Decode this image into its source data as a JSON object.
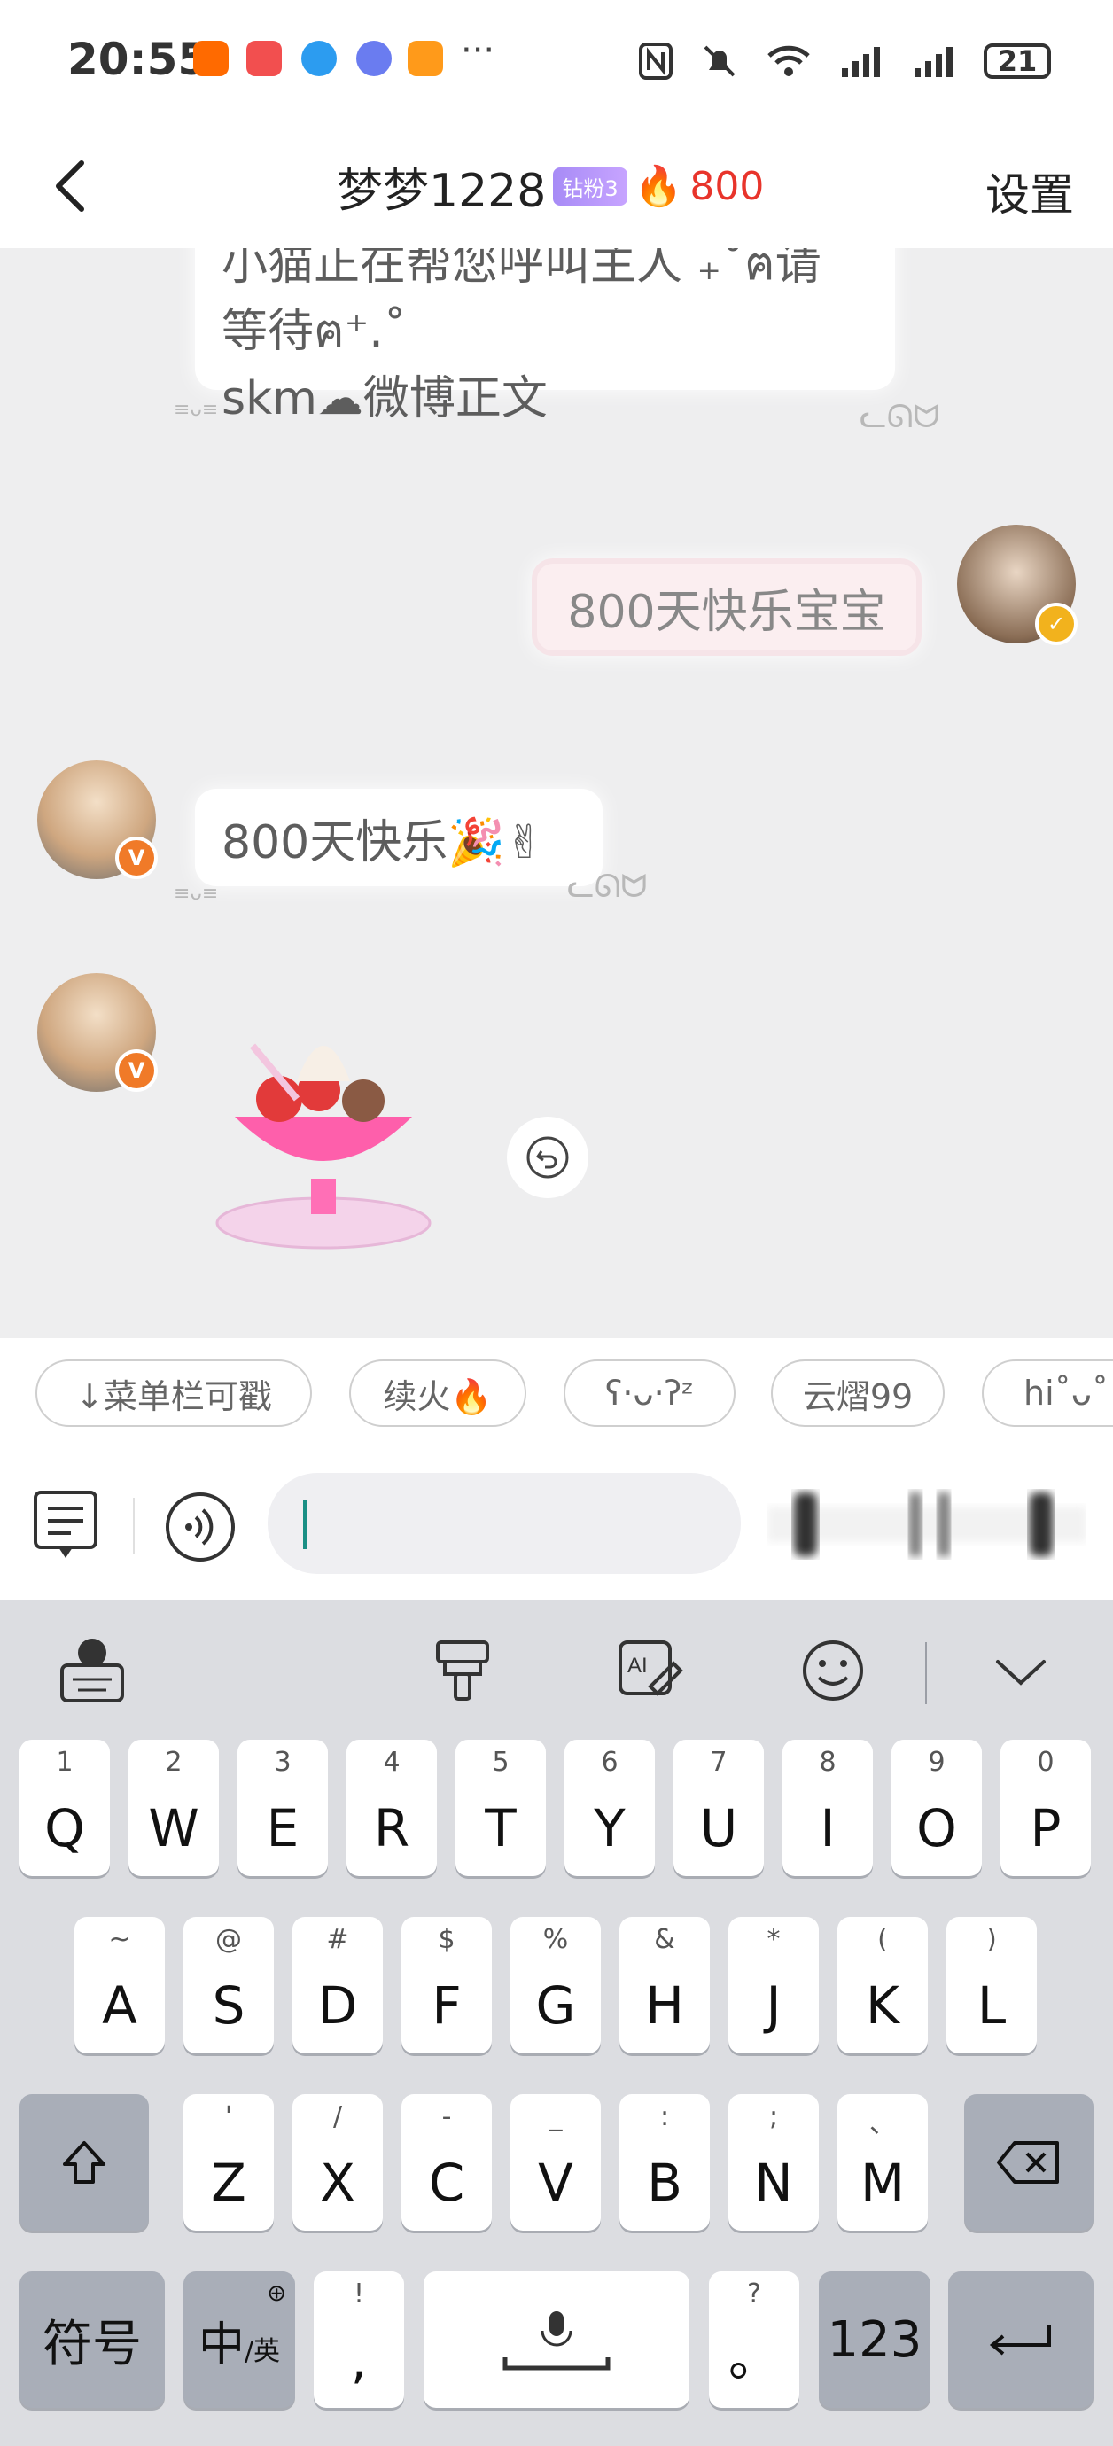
{
  "status_bar": {
    "time": "20:55",
    "more": "···",
    "battery": "21"
  },
  "header": {
    "back_icon": "chevron-left-icon",
    "title": "梦梦1228",
    "fan_badge": "钻粉3",
    "flame_icon": "🔥",
    "flame_count": "800",
    "settings": "设置"
  },
  "messages": {
    "msg1_line1": "小猫正在帮您呼叫主人 ₊˚ฅ请",
    "msg1_line2": "等待ฅ⁺.˚",
    "msg1_line3": "skm☁微博正文",
    "msg2": "800天快乐宝宝",
    "msg3": "800天快乐🎉✌",
    "decor_tag": "≡ᴗ≡"
  },
  "chips": [
    {
      "label": "↓菜单栏可戳"
    },
    {
      "label": "续火🔥"
    },
    {
      "label": "ʕ·ᴗ·ʔᶻ"
    },
    {
      "label": "云熠99"
    },
    {
      "label": "hi˚ᴗ˚"
    }
  ],
  "keyboard": {
    "row1": [
      {
        "sub": "1",
        "main": "Q"
      },
      {
        "sub": "2",
        "main": "W"
      },
      {
        "sub": "3",
        "main": "E"
      },
      {
        "sub": "4",
        "main": "R"
      },
      {
        "sub": "5",
        "main": "T"
      },
      {
        "sub": "6",
        "main": "Y"
      },
      {
        "sub": "7",
        "main": "U"
      },
      {
        "sub": "8",
        "main": "I"
      },
      {
        "sub": "9",
        "main": "O"
      },
      {
        "sub": "0",
        "main": "P"
      }
    ],
    "row2": [
      {
        "sub": "~",
        "main": "A"
      },
      {
        "sub": "@",
        "main": "S"
      },
      {
        "sub": "#",
        "main": "D"
      },
      {
        "sub": "$",
        "main": "F"
      },
      {
        "sub": "%",
        "main": "G"
      },
      {
        "sub": "&",
        "main": "H"
      },
      {
        "sub": "*",
        "main": "J"
      },
      {
        "sub": "(",
        "main": "K"
      },
      {
        "sub": ")",
        "main": "L"
      }
    ],
    "row3": [
      {
        "sub": "'",
        "main": "Z"
      },
      {
        "sub": "/",
        "main": "X"
      },
      {
        "sub": "-",
        "main": "C"
      },
      {
        "sub": "_",
        "main": "V"
      },
      {
        "sub": ":",
        "main": "B"
      },
      {
        "sub": ";",
        "main": "N"
      },
      {
        "sub": "、",
        "main": "M"
      }
    ],
    "symbols_label": "符号",
    "lang_main": "中",
    "lang_sub": "/英",
    "comma_sub": "!",
    "comma_main": ",",
    "period_sub": "?",
    "period_main": "。",
    "num_label": "123"
  },
  "colors": {
    "accent_teal": "#1a8f85",
    "flame_red": "#e8342b",
    "badge_purple": "#a78bf6",
    "verified_orange": "#f07a28",
    "verified_gold": "#f2b21d"
  }
}
